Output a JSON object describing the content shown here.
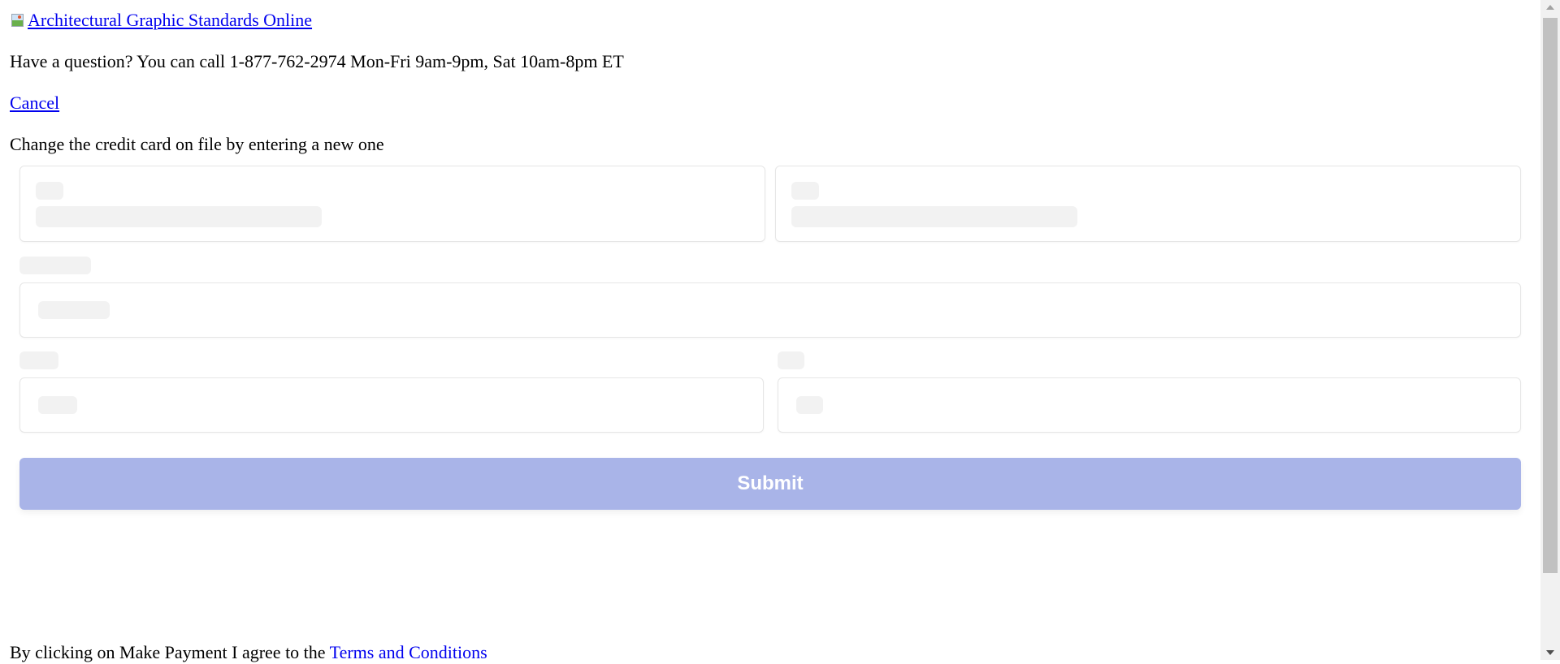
{
  "header": {
    "logo_alt": "Architectural Graphic Standards Online",
    "help_text": "Have a question? You can call 1-877-762-2974 Mon-Fri 9am-9pm, Sat 10am-8pm ET",
    "cancel_label": "Cancel"
  },
  "form": {
    "instruction": "Change the credit card on file by entering a new one",
    "submit_label": "Submit",
    "submit_color": "#a9b4e8",
    "skeleton_color": "#f2f2f2",
    "border_color": "#e6e6e6"
  },
  "footer": {
    "terms_prefix": "By clicking on Make Payment I agree to the ",
    "terms_link": "Terms and Conditions"
  },
  "colors": {
    "link": "#0000ee",
    "scrollbar_track": "#f1f1f1",
    "scrollbar_thumb": "#c1c1c1"
  }
}
